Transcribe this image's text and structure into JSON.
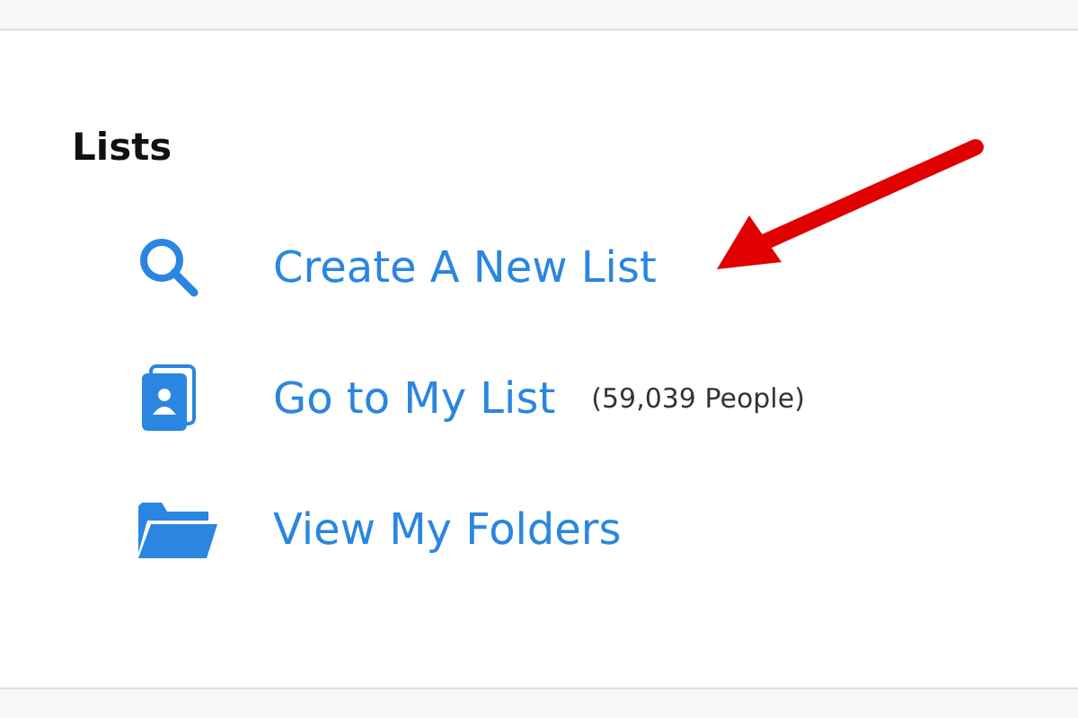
{
  "section": {
    "title": "Lists"
  },
  "items": [
    {
      "kind": "search",
      "label": "Create A New List"
    },
    {
      "kind": "contacts",
      "label": "Go to My List",
      "count": "(59,039 People)"
    },
    {
      "kind": "folder",
      "label": "View My Folders"
    }
  ]
}
